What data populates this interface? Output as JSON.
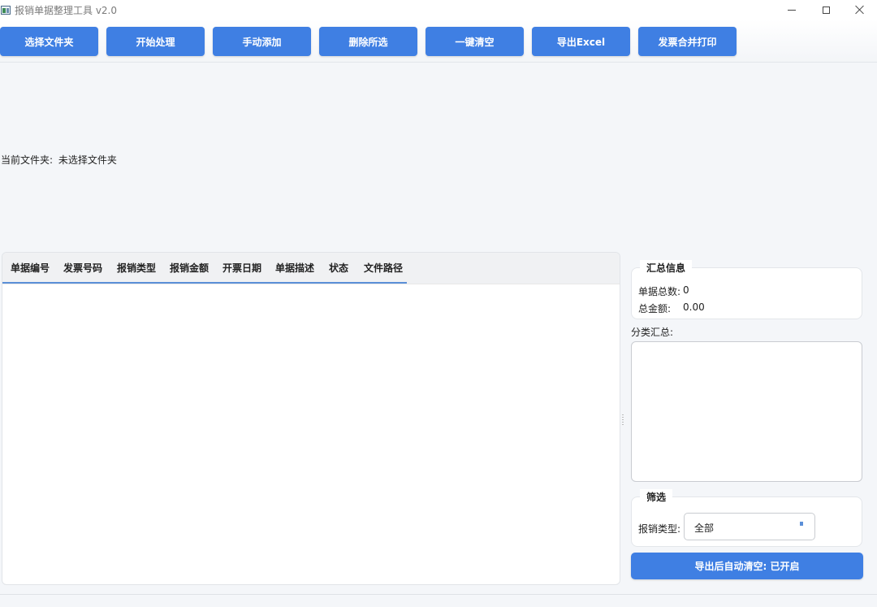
{
  "window": {
    "title": "报销单据整理工具 v2.0"
  },
  "toolbar": {
    "buttons": [
      {
        "label": "选择文件夹"
      },
      {
        "label": "开始处理"
      },
      {
        "label": "手动添加"
      },
      {
        "label": "删除所选"
      },
      {
        "label": "一键清空"
      },
      {
        "label": "导出Excel"
      },
      {
        "label": "发票合并打印"
      }
    ]
  },
  "folder": {
    "label": "当前文件夹:",
    "value": "未选择文件夹"
  },
  "table": {
    "columns": [
      "单据编号",
      "发票号码",
      "报销类型",
      "报销金额",
      "开票日期",
      "单据描述",
      "状态",
      "文件路径"
    ],
    "rows": []
  },
  "summary": {
    "title": "汇总信息",
    "count_label": "单据总数:",
    "count_value": "0",
    "amount_label": "总金额:",
    "amount_value": "0.00"
  },
  "category": {
    "label": "分类汇总:"
  },
  "filter": {
    "title": "筛选",
    "type_label": "报销类型:",
    "type_value": "全部"
  },
  "auto_clear": {
    "label": "导出后自动清空: 已开启"
  },
  "colors": {
    "accent": "#3f7fe3",
    "underline": "#5b8fd8",
    "background": "#f4f6f9"
  }
}
